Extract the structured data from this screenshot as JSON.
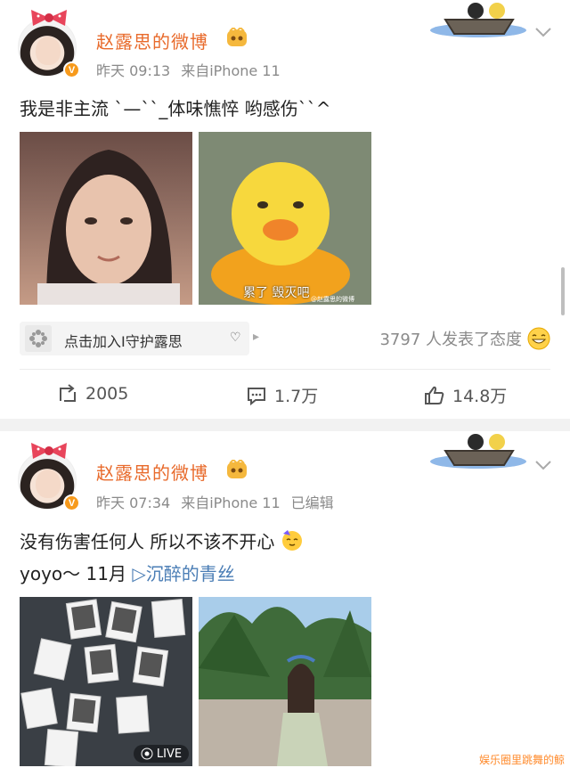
{
  "posts": [
    {
      "username": "赵露思的微博",
      "time": "昨天 09:13",
      "source": "来自iPhone 11",
      "edited": "",
      "text": "我是非主流 `—``_体味憔悴 哟感伤``^",
      "photo2_caption": "累了 毁灭吧",
      "photo2_watermark": "@赵露思的微博",
      "chip_label": "点击加入I守护露思",
      "reactions": "3797 人发表了态度",
      "repost": "2005",
      "comment": "1.7万",
      "like": "14.8万"
    },
    {
      "username": "赵露思的微博",
      "time": "昨天 07:34",
      "source": "来自iPhone 11",
      "edited": "已编辑",
      "text": "没有伤害任何人 所以不该不开心",
      "text2": "yoyo～ 11月",
      "link": "▷沉醉的青丝",
      "live_label": "LIVE"
    }
  ],
  "watermark": "娱乐圈里跳舞的鲸",
  "colors": {
    "username": "#e86a2b",
    "link": "#4a7db5",
    "vip": "#f79a1c"
  },
  "icons": [
    "bow-icon",
    "vip-badge-icon",
    "member-icon",
    "boat-sticker-icon",
    "chevron-down-icon",
    "fan-group-icon",
    "heart-icon",
    "grin-emoji-icon",
    "repost-icon",
    "comment-icon",
    "like-icon",
    "party-emoji-icon",
    "live-icon"
  ]
}
